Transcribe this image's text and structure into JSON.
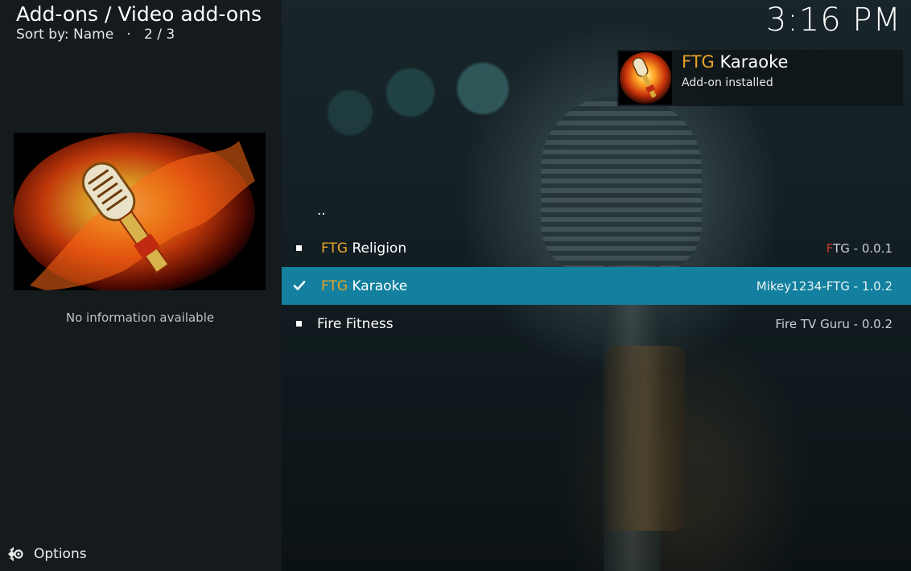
{
  "header": {
    "breadcrumb": "Add-ons / Video add-ons",
    "sort_label": "Sort by: Name",
    "separator": "·",
    "position": "2 / 3"
  },
  "clock": "3:16 PM",
  "notification": {
    "title_prefix": "FTG",
    "title_rest": "Karaoke",
    "message": "Add-on installed"
  },
  "info_panel": {
    "text": "No information available"
  },
  "footer": {
    "options_label": "Options"
  },
  "list": {
    "parent": "..",
    "items": [
      {
        "prefix": "FTG",
        "name": "Religion",
        "meta_f": "F",
        "meta_tg": "TG",
        "meta_rest": " - 0.0.1",
        "state": "bullet"
      },
      {
        "prefix": "FTG",
        "name": "Karaoke",
        "meta": "Mikey1234-FTG - 1.0.2",
        "state": "installed",
        "selected": true
      },
      {
        "prefix": "",
        "name": "Fire Fitness",
        "meta": "Fire TV Guru - 0.0.2",
        "state": "bullet"
      }
    ]
  },
  "colors": {
    "accent_orange": "#e8a526",
    "selection_blue": "#12809e",
    "sidebar_bg": "#151a1c"
  }
}
